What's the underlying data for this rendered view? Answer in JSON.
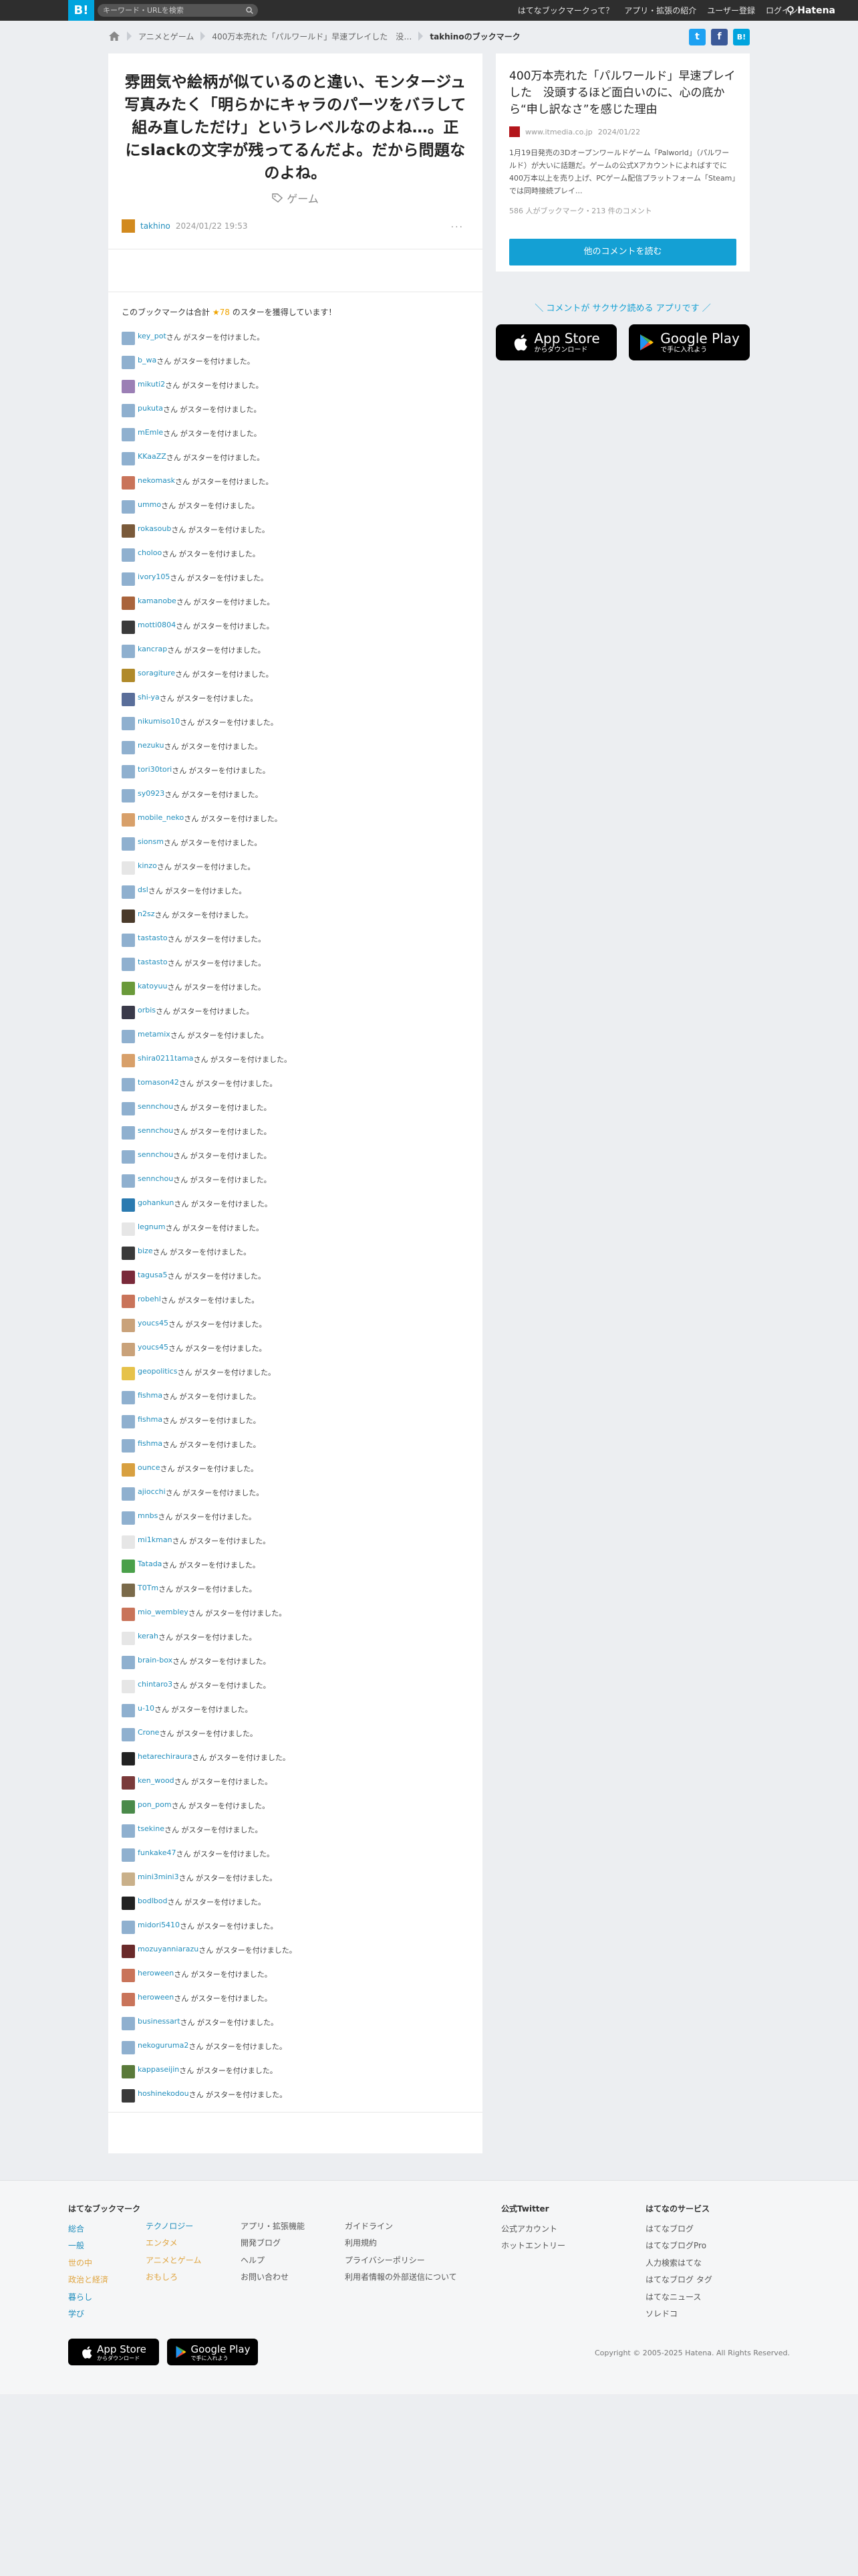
{
  "header": {
    "logo": "B!",
    "search_placeholder": "キーワード・URLを検索",
    "nav": [
      "はてなブックマークって？",
      "アプリ・拡張の紹介",
      "ユーザー登録",
      "ログイン"
    ],
    "brand": "Hatena"
  },
  "breadcrumb": [
    "アニメとゲーム",
    "400万本売れた「パルワールド」早速プレイした　没…",
    "takhinoのブックマーク"
  ],
  "social": {
    "twitter": "t",
    "facebook": "f",
    "hatena": "B!"
  },
  "entry": {
    "comment": "雰囲気や絵柄が似ているのと違い、モンタージュ写真みたく「明らかにキャラのパーツをバラして組み直しただけ」というレベルなのよね…。正にslackの文字が残ってるんだよ。だから問題なのよね。",
    "tag": "ゲーム",
    "user": "takhino",
    "date": "2024/01/22 19:53",
    "more": "···"
  },
  "stars_intro": {
    "prefix": "このブックマークは合計",
    "count": "★78",
    "suffix": "のスターを獲得しています！"
  },
  "star_suffix": "さん がスターを付けました。",
  "star_users": [
    {
      "name": "key_pot",
      "color": "#8fb0cf"
    },
    {
      "name": "b_wa",
      "color": "#8fb0cf"
    },
    {
      "name": "mikuti2",
      "color": "#9b7fb5"
    },
    {
      "name": "pukuta",
      "color": "#8fb0cf"
    },
    {
      "name": "mEmle",
      "color": "#8fb0cf"
    },
    {
      "name": "KKaaZZ",
      "color": "#8fb0cf"
    },
    {
      "name": "nekomask",
      "color": "#c9745a"
    },
    {
      "name": "ummo",
      "color": "#8fb0cf"
    },
    {
      "name": "rokasoub",
      "color": "#7a5a3a"
    },
    {
      "name": "choloo",
      "color": "#8fb0cf"
    },
    {
      "name": "ivory105",
      "color": "#8fb0cf"
    },
    {
      "name": "kamanobe",
      "color": "#a9643c"
    },
    {
      "name": "motti0804",
      "color": "#3a3a3a"
    },
    {
      "name": "kancrap",
      "color": "#8fb0cf"
    },
    {
      "name": "soragiture",
      "color": "#b08a2a"
    },
    {
      "name": "shi-ya",
      "color": "#5a6e9a"
    },
    {
      "name": "nikumiso10",
      "color": "#8fb0cf"
    },
    {
      "name": "nezuku",
      "color": "#8fb0cf"
    },
    {
      "name": "tori30tori",
      "color": "#8fb0cf"
    },
    {
      "name": "sy0923",
      "color": "#8fb0cf"
    },
    {
      "name": "mobile_neko",
      "color": "#d8a06a"
    },
    {
      "name": "sionsm",
      "color": "#8fb0cf"
    },
    {
      "name": "kinzo",
      "color": "#e6e6e6"
    },
    {
      "name": "dsl",
      "color": "#8fb0cf"
    },
    {
      "name": "n2sz",
      "color": "#4a3a2a"
    },
    {
      "name": "tastasto",
      "color": "#8fb0cf"
    },
    {
      "name": "tastasto",
      "color": "#8fb0cf"
    },
    {
      "name": "katoyuu",
      "color": "#6a9a3a"
    },
    {
      "name": "orbis",
      "color": "#3a3a4a"
    },
    {
      "name": "metamix",
      "color": "#8fb0cf"
    },
    {
      "name": "shira0211tama",
      "color": "#d8a06a"
    },
    {
      "name": "tomason42",
      "color": "#8fb0cf"
    },
    {
      "name": "sennchou",
      "color": "#8fb0cf"
    },
    {
      "name": "sennchou",
      "color": "#8fb0cf"
    },
    {
      "name": "sennchou",
      "color": "#8fb0cf"
    },
    {
      "name": "sennchou",
      "color": "#8fb0cf"
    },
    {
      "name": "gohankun",
      "color": "#2a7ab0"
    },
    {
      "name": "legnum",
      "color": "#e6e6e6"
    },
    {
      "name": "bize",
      "color": "#3a3a3a"
    },
    {
      "name": "tagusa5",
      "color": "#7a2a3a"
    },
    {
      "name": "robehl",
      "color": "#c9745a"
    },
    {
      "name": "youcs45",
      "color": "#c9a27a"
    },
    {
      "name": "youcs45",
      "color": "#c9a27a"
    },
    {
      "name": "geopolitics",
      "color": "#e6c24a"
    },
    {
      "name": "fishma",
      "color": "#8fb0cf"
    },
    {
      "name": "fishma",
      "color": "#8fb0cf"
    },
    {
      "name": "fishma",
      "color": "#8fb0cf"
    },
    {
      "name": "ounce",
      "color": "#d8a040"
    },
    {
      "name": "ajiocchi",
      "color": "#8fb0cf"
    },
    {
      "name": "mnbs",
      "color": "#8fb0cf"
    },
    {
      "name": "mi1kman",
      "color": "#e6e6e6"
    },
    {
      "name": "Tatada",
      "color": "#4aa04a"
    },
    {
      "name": "T0Tm",
      "color": "#7a6a4a"
    },
    {
      "name": "mio_wembley",
      "color": "#c9745a"
    },
    {
      "name": "kerah",
      "color": "#e6e6e6"
    },
    {
      "name": "brain-box",
      "color": "#8fb0cf"
    },
    {
      "name": "chintaro3",
      "color": "#e6e6e6"
    },
    {
      "name": "u-10",
      "color": "#8fb0cf"
    },
    {
      "name": "Crone",
      "color": "#8fb0cf"
    },
    {
      "name": "hetarechiraura",
      "color": "#222222"
    },
    {
      "name": "ken_wood",
      "color": "#7a3a3a"
    },
    {
      "name": "pon_pom",
      "color": "#4a8a4a"
    },
    {
      "name": "tsekine",
      "color": "#8fb0cf"
    },
    {
      "name": "funkake47",
      "color": "#8fb0cf"
    },
    {
      "name": "mini3mini3",
      "color": "#c9b08a"
    },
    {
      "name": "bodlbod",
      "color": "#222222"
    },
    {
      "name": "midori5410",
      "color": "#8fb0cf"
    },
    {
      "name": "mozuyanniarazu",
      "color": "#6a2a2a"
    },
    {
      "name": "heroween",
      "color": "#c9745a"
    },
    {
      "name": "heroween",
      "color": "#c9745a"
    },
    {
      "name": "businessart",
      "color": "#8fb0cf"
    },
    {
      "name": "nekoguruma2",
      "color": "#8fb0cf"
    },
    {
      "name": "kappaseijin",
      "color": "#5a7a3a"
    },
    {
      "name": "hoshinekodou",
      "color": "#3a3a3a"
    }
  ],
  "sidebar": {
    "title": "400万本売れた「パルワールド」早速プレイした　没頭するほど面白いのに、心の底から“申し訳なさ”を感じた理由",
    "site": "www.itmedia.co.jp",
    "date": "2024/01/22",
    "summary": "1月19日発売の3Dオープンワールドゲーム「Palworld」（パルワールド）が大いに話題だ。ゲームの公式Xアカウントによればすでに400万本以上を売り上げ、PCゲーム配信プラットフォーム「Steam」では同時接続プレイ...",
    "bookmarks": "586 人がブックマーク・213 件のコメント",
    "button": "他のコメントを読む",
    "promo": "＼ コメントが サクサク読める アプリです ／",
    "appstore_small": "からダウンロード",
    "appstore_big": "App Store",
    "googleplay_small": "で手に入れよう",
    "googleplay_big": "Google Play"
  },
  "footer": {
    "col1_title": "はてなブックマーク",
    "cat1": [
      "総合",
      "一般",
      "世の中",
      "政治と経済",
      "暮らし",
      "学び"
    ],
    "cat2": [
      "テクノロジー",
      "エンタメ",
      "アニメとゲーム",
      "おもしろ"
    ],
    "col3": [
      "アプリ・拡張機能",
      "開発ブログ",
      "ヘルプ",
      "お問い合わせ"
    ],
    "col4": [
      "ガイドライン",
      "利用規約",
      "プライバシーポリシー",
      "利用者情報の外部送信について"
    ],
    "tw_title": "公式Twitter",
    "tw": [
      "公式アカウント",
      "ホットエントリー"
    ],
    "svc_title": "はてなのサービス",
    "svc": [
      "はてなブログ",
      "はてなブログPro",
      "人力検索はてな",
      "はてなブログ タグ",
      "はてなニュース",
      "ソレドコ"
    ],
    "appstore_small": "からダウンロード",
    "appstore_big": "App Store",
    "googleplay_small": "で手に入れよう",
    "googleplay_big": "Google Play",
    "copyright": "Copyright © 2005-2025 Hatena. All Rights Reserved."
  }
}
